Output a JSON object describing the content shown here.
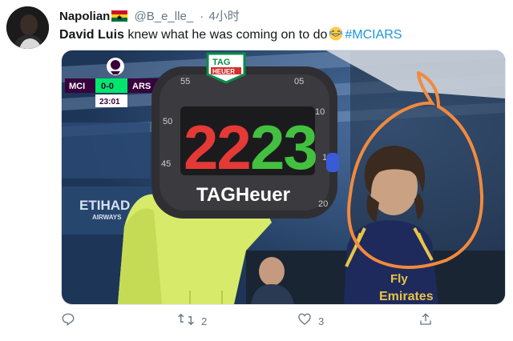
{
  "tweet": {
    "display_name": "Napolian",
    "handle": "@B_e_lle_",
    "separator": "·",
    "time_ago": "4小时",
    "text": {
      "bold_part": "David Luis",
      "plain_part": " knew what he was coming on to do",
      "hashtag": "#MCIARS"
    }
  },
  "media": {
    "scoreboard": {
      "home": "MCI",
      "score": "0-0",
      "away": "ARS",
      "clock": "23:01"
    },
    "board": {
      "brand_top": "TAG",
      "brand_sub": "HEUER",
      "brand_bottom": "TAGHeuer",
      "dial_numbers": [
        "55",
        "05",
        "10",
        "50",
        "15",
        "45",
        "20"
      ],
      "left_number": "22",
      "right_number": "23"
    },
    "stadium_sign": "ETIHAD",
    "stadium_sign_sub": "AIRWAYS",
    "shirt_sponsor_top": "Fly",
    "shirt_sponsor_bottom": "Emirates"
  },
  "actions": {
    "reply_count": "",
    "retweet_count": "2",
    "like_count": "3"
  },
  "colors": {
    "hashtag": "#1b95e0",
    "highlight_circle": "#f28a3c",
    "led_red": "#e53935",
    "led_green": "#43c040"
  }
}
